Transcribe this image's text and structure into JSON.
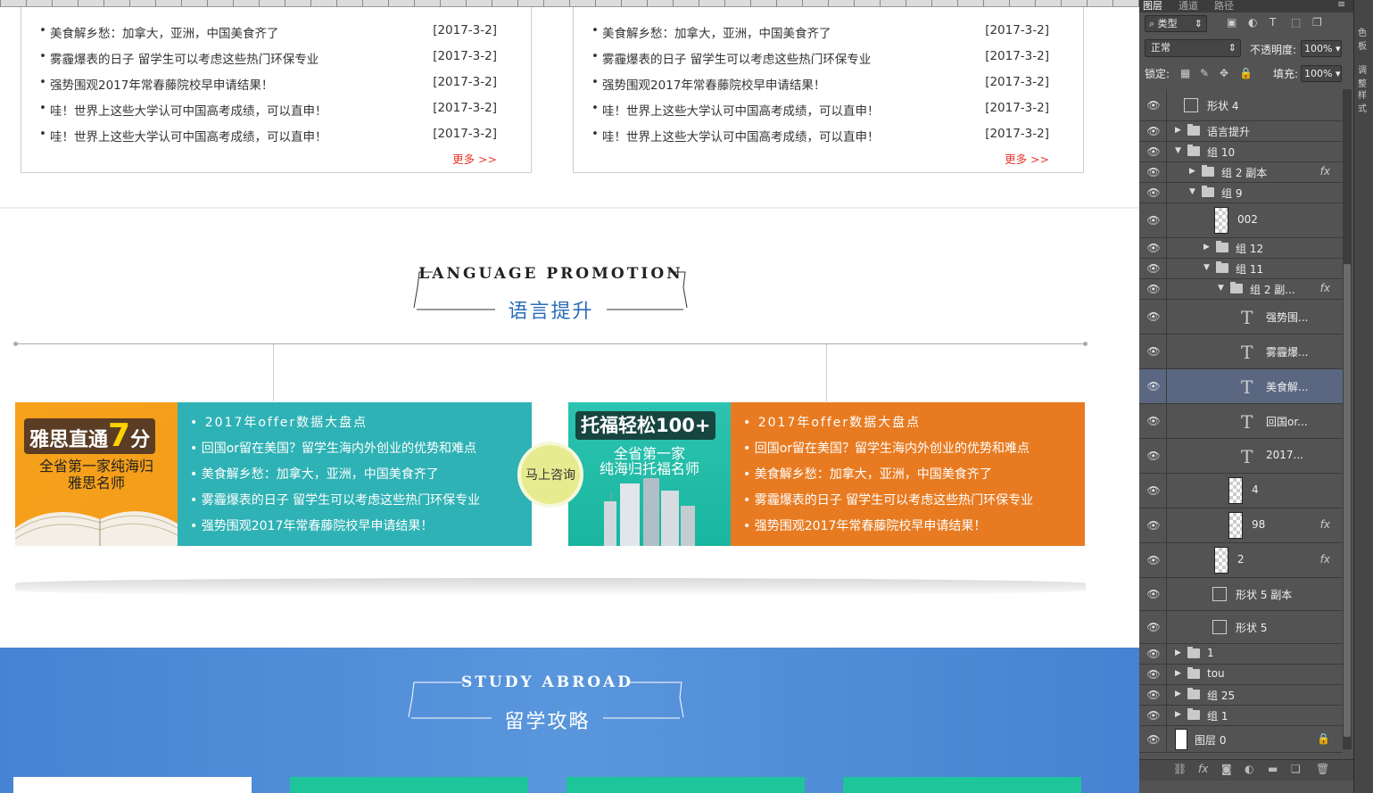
{
  "news_left": {
    "rows": [
      {
        "title": "美食解乡愁：加拿大，亚洲，中国美食齐了",
        "date": "[2017-3-2]"
      },
      {
        "title": "雾霾爆表的日子 留学生可以考虑这些热门环保专业",
        "date": "[2017-3-2]"
      },
      {
        "title": "强势围观2017年常春藤院校早申请结果！",
        "date": "[2017-3-2]"
      },
      {
        "title": "哇！世界上这些大学认可中国高考成绩，可以直申！",
        "date": "[2017-3-2]"
      },
      {
        "title": "哇！世界上这些大学认可中国高考成绩，可以直申！",
        "date": "[2017-3-2]"
      }
    ],
    "more": "更多 >>"
  },
  "news_right": {
    "rows": [
      {
        "title": "美食解乡愁：加拿大，亚洲，中国美食齐了",
        "date": "[2017-3-2]"
      },
      {
        "title": "雾霾爆表的日子 留学生可以考虑这些热门环保专业",
        "date": "[2017-3-2]"
      },
      {
        "title": "强势围观2017年常春藤院校早申请结果！",
        "date": "[2017-3-2]"
      },
      {
        "title": "哇！世界上这些大学认可中国高考成绩，可以直申！",
        "date": "[2017-3-2]"
      },
      {
        "title": "哇！世界上这些大学认可中国高考成绩，可以直申！",
        "date": "[2017-3-2]"
      }
    ],
    "more": "更多 >>"
  },
  "language": {
    "en": "LANGUAGE PROMOTION",
    "cn": "语言提升"
  },
  "promo_left": {
    "img_title": "雅思直通",
    "img_num": "7",
    "img_unit": "分",
    "img_sub1": "全省第一家纯海归",
    "img_sub2": "雅思名师",
    "color": "#2fb2b5",
    "items": [
      "2017年offer数据大盘点",
      "回国or留在美国？留学生海内外创业的优势和难点",
      "美食解乡愁：加拿大，亚洲，中国美食齐了",
      "雾霾爆表的日子 留学生可以考虑这些热门环保专业",
      "强势围观2017年常春藤院校早申请结果！"
    ]
  },
  "promo_right": {
    "img_title": "托福轻松100+",
    "img_sub1": "全省第一家",
    "img_sub2": "纯海归托福名师",
    "color": "#e87b21",
    "items": [
      "2017年offer数据大盘点",
      "回国or留在美国？留学生海内外创业的优势和难点",
      "美食解乡愁：加拿大，亚洲，中国美食齐了",
      "雾霾爆表的日子 留学生可以考虑这些热门环保专业",
      "强势围观2017年常春藤院校早申请结果！"
    ]
  },
  "consult": "马上咨询",
  "study": {
    "en": "STUDY ABROAD",
    "cn": "留学攻略"
  },
  "ps": {
    "tabs": [
      "图层",
      "通道",
      "路径"
    ],
    "side": [
      "色板",
      "调整",
      "样式"
    ],
    "filter_kind": "类型",
    "blend_mode": "正常",
    "opacity_label": "不透明度:",
    "opacity": "100%",
    "lock_label": "锁定:",
    "fill_label": "填充:",
    "fill": "100%",
    "layers": [
      {
        "name": "形状 4",
        "kind": "shape",
        "indent": 0
      },
      {
        "name": "语言提升",
        "kind": "folder",
        "indent": 0,
        "open": false
      },
      {
        "name": "组 10",
        "kind": "folder",
        "indent": 0,
        "open": true
      },
      {
        "name": "组 2 副本",
        "kind": "folder",
        "indent": 1,
        "open": false,
        "fx": true
      },
      {
        "name": "组 9",
        "kind": "folder",
        "indent": 1,
        "open": true
      },
      {
        "name": "002",
        "kind": "thumb",
        "indent": 2
      },
      {
        "name": "组 12",
        "kind": "folder",
        "indent": 2,
        "open": false
      },
      {
        "name": "组 11",
        "kind": "folder",
        "indent": 2,
        "open": true
      },
      {
        "name": "组 2 副...",
        "kind": "folder",
        "indent": 3,
        "open": true,
        "fx": true
      },
      {
        "name": "强势围...",
        "kind": "text",
        "indent": 4
      },
      {
        "name": "雾霾爆...",
        "kind": "text",
        "indent": 4
      },
      {
        "name": "美食解...",
        "kind": "text",
        "indent": 4,
        "selected": true
      },
      {
        "name": "回国or...",
        "kind": "text",
        "indent": 4
      },
      {
        "name": "2017...",
        "kind": "text",
        "indent": 4
      },
      {
        "name": "4",
        "kind": "thumb",
        "indent": 3
      },
      {
        "name": "98",
        "kind": "thumb",
        "indent": 3,
        "fx": true
      },
      {
        "name": "2",
        "kind": "thumb",
        "indent": 2,
        "fx": true
      },
      {
        "name": "形状 5 副本",
        "kind": "shape",
        "indent": 2
      },
      {
        "name": "形状 5",
        "kind": "shape",
        "indent": 2
      },
      {
        "name": "1",
        "kind": "folder",
        "indent": 0,
        "open": false
      },
      {
        "name": "tou",
        "kind": "folder",
        "indent": 0,
        "open": false
      },
      {
        "name": "组 25",
        "kind": "folder",
        "indent": 0,
        "open": false
      },
      {
        "name": "组 1",
        "kind": "folder",
        "indent": 0,
        "open": false
      },
      {
        "name": "图层 0",
        "kind": "white",
        "indent": 0,
        "lock": true
      }
    ]
  }
}
